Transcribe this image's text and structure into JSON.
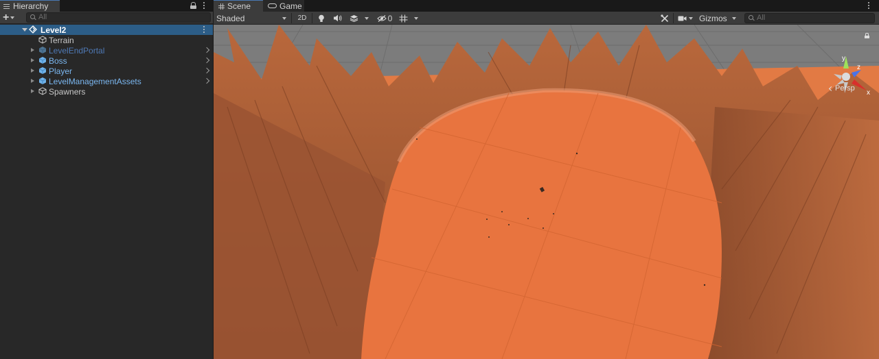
{
  "hierarchy": {
    "tab_label": "Hierarchy",
    "search_placeholder": "All",
    "items": [
      {
        "label": "Level2",
        "kind": "scene",
        "selected": true,
        "expanded": true,
        "color": "#ffffff"
      },
      {
        "label": "Terrain",
        "kind": "gameobject",
        "color": "#c4c4c4"
      },
      {
        "label": "LevelEndPortal",
        "kind": "prefab",
        "color": "#4f79b5",
        "inactive": true
      },
      {
        "label": "Boss",
        "kind": "prefab",
        "color": "#7bb7f0"
      },
      {
        "label": "Player",
        "kind": "prefab",
        "color": "#7bb7f0"
      },
      {
        "label": "LevelManagementAssets",
        "kind": "prefab",
        "color": "#7bb7f0"
      },
      {
        "label": "Spawners",
        "kind": "gameobject",
        "color": "#c4c4c4"
      }
    ]
  },
  "scene_view": {
    "tabs": [
      {
        "label": "Scene",
        "icon": "grid-icon",
        "active": true
      },
      {
        "label": "Game",
        "icon": "gamepad-icon",
        "active": false
      }
    ],
    "toolbar": {
      "draw_mode": "Shaded",
      "mode_2d": "2D",
      "hidden_count": "0",
      "gizmos_label": "Gizmos",
      "search_placeholder": "All"
    },
    "orientation": {
      "label": "Persp",
      "axes": {
        "x": "x",
        "y": "y",
        "z": "z"
      }
    }
  },
  "colors": {
    "terrain_floor": "#e8743f",
    "terrain_walls": "#a65a33",
    "selection": "#2c5d87",
    "prefab_blue": "#7bb7f0"
  }
}
